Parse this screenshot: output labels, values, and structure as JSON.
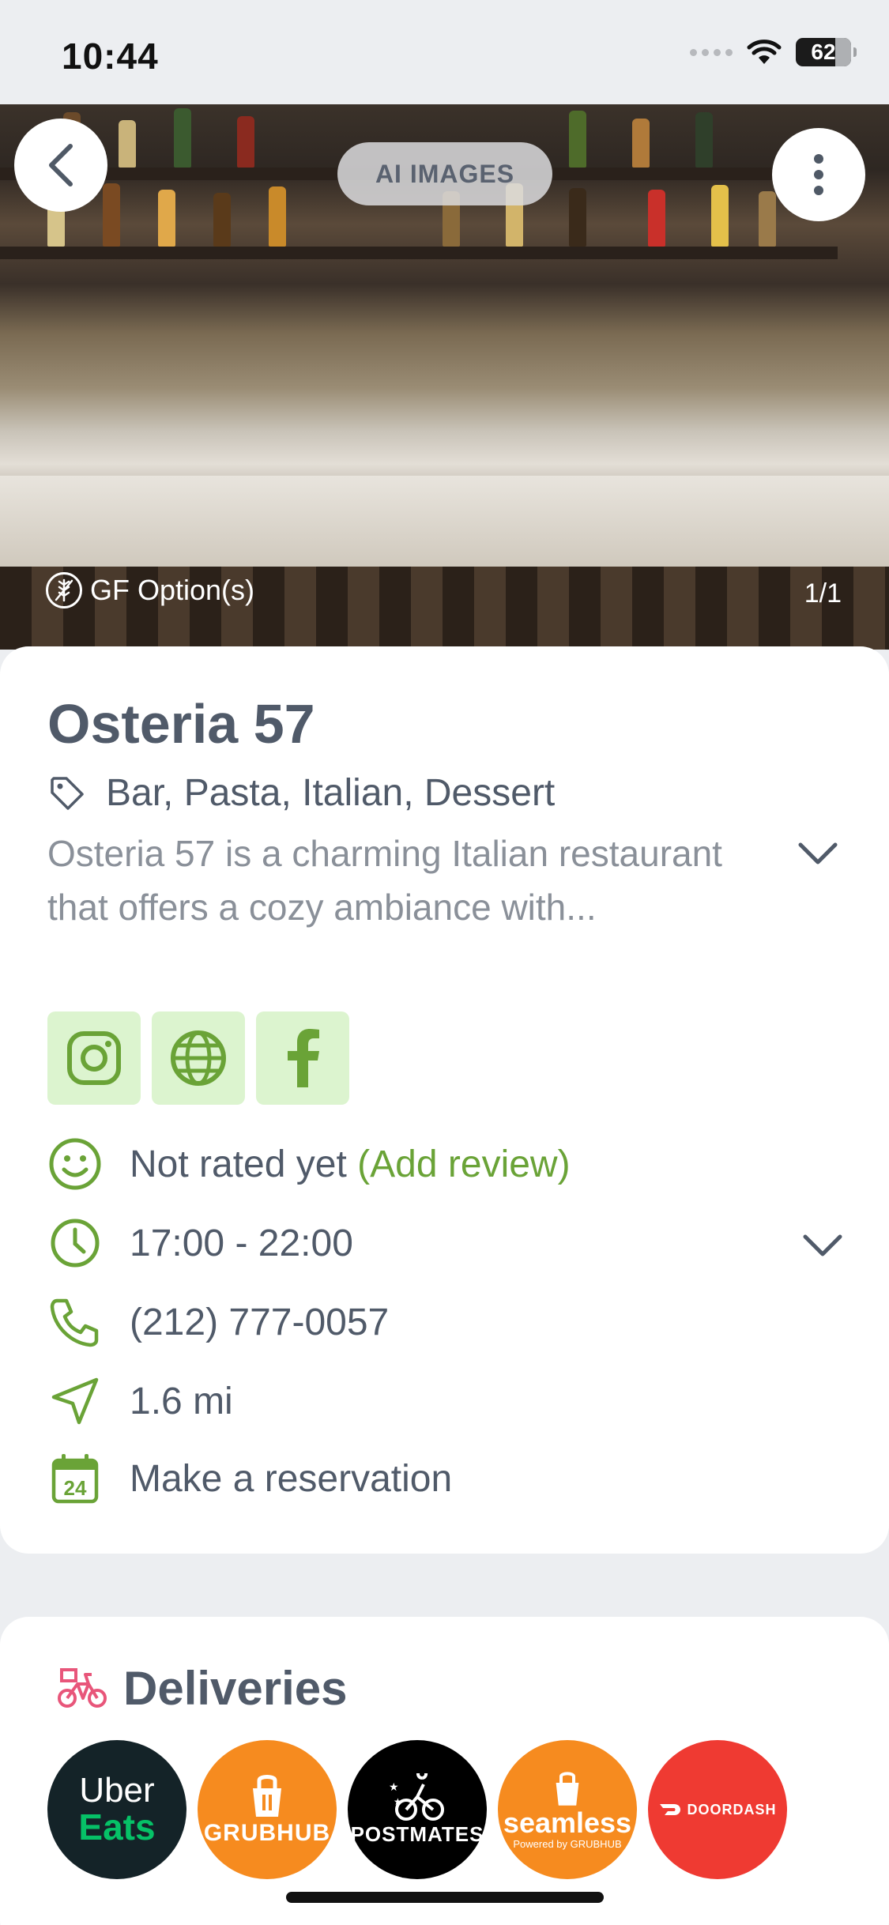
{
  "status": {
    "time": "10:44",
    "battery": "62"
  },
  "hero": {
    "ai_label": "AI IMAGES",
    "badge": "GF Option(s)",
    "counter": "1/1"
  },
  "restaurant": {
    "name": "Osteria 57",
    "tags": "Bar, Pasta, Italian, Dessert",
    "description": "Osteria 57 is a charming Italian restaurant that offers a cozy ambiance with...",
    "rating_text": "Not rated yet",
    "add_review": "(Add review)",
    "hours": "17:00 - 22:00",
    "phone": "(212) 777-0057",
    "distance": "1.6 mi",
    "reservation": "Make a reservation",
    "calendar_day": "24"
  },
  "social": [
    "instagram-icon",
    "globe-icon",
    "facebook-icon"
  ],
  "deliveries": {
    "title": "Deliveries",
    "services": [
      {
        "line1": "Uber",
        "line2": "Eats",
        "color": "#142328"
      },
      {
        "line1": "GRUBHUB",
        "line2": "",
        "color": "#f68b1f"
      },
      {
        "line1": "POSTMATES",
        "line2": "",
        "color": "#000000"
      },
      {
        "line1": "seamless",
        "line2": "Powered by GRUBHUB",
        "color": "#f68b1f"
      },
      {
        "line1": "DOORDASH",
        "line2": "",
        "color": "#ef3a32"
      }
    ]
  },
  "colors": {
    "accent_green": "#6aa337",
    "social_bg": "#dcf4cf",
    "text": "#505a69",
    "muted": "#8a9099"
  }
}
